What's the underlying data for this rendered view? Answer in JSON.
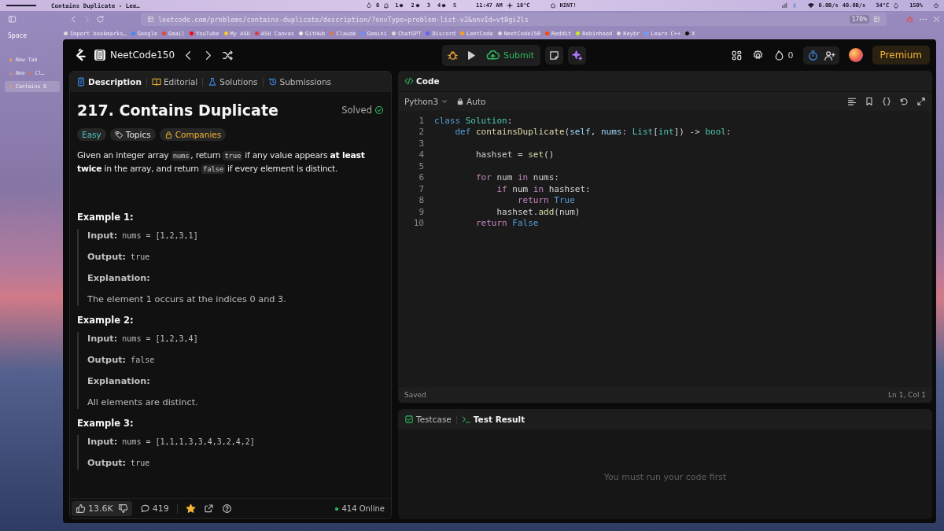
{
  "system_bar": {
    "window_title": "Contains Duplicate - Lee…",
    "drop_count": "0",
    "workspaces": [
      {
        "label": "1",
        "occupied": true
      },
      {
        "label": "2",
        "occupied": true
      },
      {
        "label": "3",
        "occupied": false
      },
      {
        "label": "4",
        "occupied": true
      },
      {
        "label": "5",
        "occupied": false
      }
    ],
    "clock": "11:47 AM",
    "weather": "18°C",
    "hint": "HINT!",
    "net_down": "0.0B/s",
    "net_up": "40.0B/s",
    "temperature": "34°C",
    "zoom": "150%"
  },
  "browser": {
    "url": "leetcode.com/problems/contains-duplicate/description/?envType=problem-list-v2&envId=vt8gi2ls",
    "zoom": "170%"
  },
  "sidebar": {
    "space_label": "Space",
    "tabs": [
      {
        "labels": [
          "New Tab"
        ],
        "selected": false
      },
      {
        "labels": [
          "Nee",
          "Cl…"
        ],
        "selected": false
      },
      {
        "labels": [
          "Contains D"
        ],
        "selected": true
      }
    ]
  },
  "bookmarks": [
    "Import bookmarks…",
    "Google",
    "Gmail",
    "YouTube",
    "My ASU",
    "ASU Canvas",
    "GitHub",
    "Claude",
    "Gemini",
    "ChatGPT",
    "Discord",
    "LeetCode",
    "NeetCode150",
    "Reddit",
    "Robinhood",
    "Keybr",
    "Learn C++",
    "X"
  ],
  "header": {
    "list_name": "NeetCode150",
    "submit": "Submit",
    "streak": "0",
    "premium": "Premium"
  },
  "description_panel": {
    "tabs": [
      {
        "label": "Description",
        "selected": true
      },
      {
        "label": "Editorial",
        "selected": false
      },
      {
        "label": "Solutions",
        "selected": false
      },
      {
        "label": "Submissions",
        "selected": false
      }
    ],
    "title": "217. Contains Duplicate",
    "status": "Solved",
    "tags": [
      {
        "label": "Easy",
        "kind": "difficulty"
      },
      {
        "label": "Topics",
        "kind": "topics"
      },
      {
        "label": "Companies",
        "kind": "companies"
      }
    ],
    "statement": [
      {
        "text": "Given an integer array ",
        "kind": "plain"
      },
      {
        "text": "nums",
        "kind": "code"
      },
      {
        "text": ", return ",
        "kind": "plain"
      },
      {
        "text": "true",
        "kind": "code"
      },
      {
        "text": " if any value appears ",
        "kind": "plain"
      },
      {
        "text": "at least twice",
        "kind": "bold"
      },
      {
        "text": " in the array, and return ",
        "kind": "plain"
      },
      {
        "text": "false",
        "kind": "code"
      },
      {
        "text": " if every element is distinct.",
        "kind": "plain"
      }
    ],
    "examples": [
      {
        "title": "Example 1:",
        "lines": [
          {
            "kind": "field",
            "label": "Input:",
            "value": "nums = [1,2,3,1]"
          },
          {
            "kind": "field",
            "label": "Output:",
            "value": "true"
          },
          {
            "kind": "heading",
            "label": "Explanation:"
          },
          {
            "kind": "text",
            "value": "The element 1 occurs at the indices 0 and 3."
          }
        ]
      },
      {
        "title": "Example 2:",
        "lines": [
          {
            "kind": "field",
            "label": "Input:",
            "value": "nums = [1,2,3,4]"
          },
          {
            "kind": "field",
            "label": "Output:",
            "value": "false"
          },
          {
            "kind": "heading",
            "label": "Explanation:"
          },
          {
            "kind": "text",
            "value": "All elements are distinct."
          }
        ]
      },
      {
        "title": "Example 3:",
        "lines": [
          {
            "kind": "field",
            "label": "Input:",
            "value": "nums = [1,1,1,3,3,4,3,2,4,2]"
          },
          {
            "kind": "field",
            "label": "Output:",
            "value": "true"
          }
        ]
      }
    ],
    "footer": {
      "likes": "13.6K",
      "comments": "419",
      "online": "414 Online"
    }
  },
  "code_panel": {
    "title": "Code",
    "language": "Python3",
    "mode": "Auto",
    "lines": [
      {
        "n": "1",
        "tokens": [
          {
            "text": "class ",
            "kind": "keyword"
          },
          {
            "text": "Solution",
            "kind": "type"
          },
          {
            "text": ":",
            "kind": "plain"
          }
        ]
      },
      {
        "n": "2",
        "tokens": [
          {
            "text": "    def ",
            "kind": "keyword"
          },
          {
            "text": "containsDuplicate",
            "kind": "function"
          },
          {
            "text": "(",
            "kind": "plain"
          },
          {
            "text": "self",
            "kind": "variable"
          },
          {
            "text": ", ",
            "kind": "plain"
          },
          {
            "text": "nums",
            "kind": "variable"
          },
          {
            "text": ": ",
            "kind": "plain"
          },
          {
            "text": "List",
            "kind": "type"
          },
          {
            "text": "[",
            "kind": "plain"
          },
          {
            "text": "int",
            "kind": "type"
          },
          {
            "text": "]) -> ",
            "kind": "plain"
          },
          {
            "text": "bool",
            "kind": "type"
          },
          {
            "text": ":",
            "kind": "plain"
          }
        ]
      },
      {
        "n": "3"
      },
      {
        "n": "4",
        "tokens": [
          {
            "text": "        hashset = ",
            "kind": "plain"
          },
          {
            "text": "set",
            "kind": "function"
          },
          {
            "text": "()",
            "kind": "plain"
          }
        ]
      },
      {
        "n": "5"
      },
      {
        "n": "6",
        "tokens": [
          {
            "text": "        for ",
            "kind": "control"
          },
          {
            "text": "num ",
            "kind": "plain"
          },
          {
            "text": "in ",
            "kind": "control"
          },
          {
            "text": "nums",
            "kind": "plain"
          },
          {
            "text": ":",
            "kind": "plain"
          }
        ]
      },
      {
        "n": "7",
        "tokens": [
          {
            "text": "            if ",
            "kind": "control"
          },
          {
            "text": "num ",
            "kind": "plain"
          },
          {
            "text": "in ",
            "kind": "control"
          },
          {
            "text": "hashset",
            "kind": "plain"
          },
          {
            "text": ":",
            "kind": "plain"
          }
        ]
      },
      {
        "n": "8",
        "tokens": [
          {
            "text": "                return ",
            "kind": "control"
          },
          {
            "text": "True",
            "kind": "keyword"
          }
        ]
      },
      {
        "n": "9",
        "tokens": [
          {
            "text": "            hashset.",
            "kind": "plain"
          },
          {
            "text": "add",
            "kind": "function"
          },
          {
            "text": "(num)",
            "kind": "plain"
          }
        ]
      },
      {
        "n": "10",
        "tokens": [
          {
            "text": "        return ",
            "kind": "control"
          },
          {
            "text": "False",
            "kind": "keyword"
          }
        ]
      }
    ],
    "status": "Saved",
    "cursor": "Ln 1, Col 1"
  },
  "result_panel": {
    "tabs": [
      {
        "label": "Testcase",
        "selected": false
      },
      {
        "label": "Test Result",
        "selected": true
      }
    ],
    "message": "You must run your code first"
  }
}
